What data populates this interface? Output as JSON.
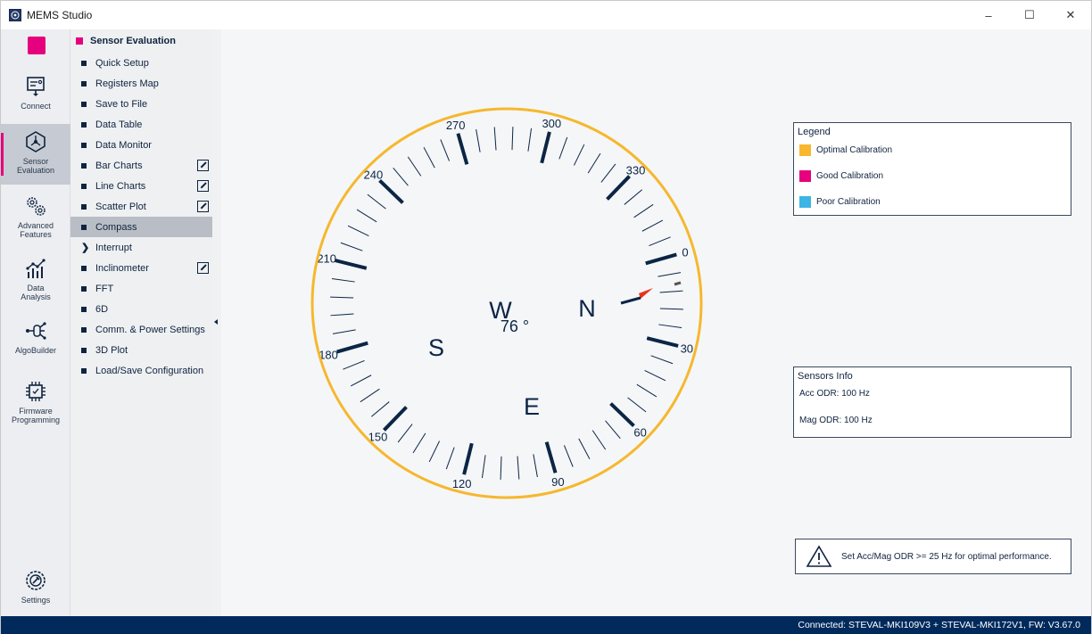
{
  "app": {
    "title": "MEMS Studio"
  },
  "window_controls": {
    "minimize": "–",
    "maximize": "☐",
    "close": "✕"
  },
  "rail": {
    "items": [
      {
        "label": "Connect",
        "icon": "connect-icon",
        "active": false
      },
      {
        "label": "Sensor Evaluation",
        "icon": "sensor-evaluation-icon",
        "active": true
      },
      {
        "label": "Advanced Features",
        "icon": "gears-icon",
        "active": false
      },
      {
        "label": "Data Analysis",
        "icon": "data-analysis-icon",
        "active": false
      },
      {
        "label": "AlgoBuilder",
        "icon": "algobuilder-icon",
        "active": false
      },
      {
        "label": "Firmware Programming",
        "icon": "chip-icon",
        "active": false
      }
    ],
    "settings_label": "Settings"
  },
  "menu": {
    "header": "Sensor Evaluation",
    "items": [
      {
        "label": "Quick Setup",
        "external": false,
        "selected": false
      },
      {
        "label": "Registers Map",
        "external": false,
        "selected": false
      },
      {
        "label": "Save to File",
        "external": false,
        "selected": false
      },
      {
        "label": "Data Table",
        "external": false,
        "selected": false
      },
      {
        "label": "Data Monitor",
        "external": false,
        "selected": false
      },
      {
        "label": "Bar Charts",
        "external": true,
        "selected": false
      },
      {
        "label": "Line Charts",
        "external": true,
        "selected": false
      },
      {
        "label": "Scatter Plot",
        "external": true,
        "selected": false
      },
      {
        "label": "Compass",
        "external": false,
        "selected": true
      },
      {
        "label": "Interrupt",
        "external": false,
        "selected": false,
        "expandable": true
      },
      {
        "label": "Inclinometer",
        "external": true,
        "selected": false
      },
      {
        "label": "FFT",
        "external": false,
        "selected": false
      },
      {
        "label": "6D",
        "external": false,
        "selected": false
      },
      {
        "label": "Comm. & Power Settings",
        "external": false,
        "selected": false
      },
      {
        "label": "3D Plot",
        "external": false,
        "selected": false
      },
      {
        "label": "Load/Save Configuration",
        "external": false,
        "selected": false
      }
    ]
  },
  "compass": {
    "heading_value": "76 °",
    "degree_labels": [
      "0",
      "30",
      "60",
      "90",
      "120",
      "150",
      "180",
      "210",
      "240",
      "270",
      "300",
      "330"
    ],
    "cardinals": {
      "north": "N",
      "east": "E",
      "south": "S",
      "west": "W"
    },
    "ring_color": "#f5b82e",
    "needle_color": "#e8341c",
    "tick_color": "#0b2545"
  },
  "legend": {
    "title": "Legend",
    "items": [
      {
        "label": "Optimal Calibration",
        "color": "#f9b72d"
      },
      {
        "label": "Good Calibration",
        "color": "#e6007e"
      },
      {
        "label": "Poor Calibration",
        "color": "#3cb4e5"
      }
    ]
  },
  "sensors_info": {
    "title": "Sensors Info",
    "acc_odr": "Acc ODR: 100 Hz",
    "mag_odr": "Mag ODR: 100 Hz"
  },
  "warning": {
    "text": "Set Acc/Mag ODR >= 25 Hz for optimal performance.",
    "icon": "warning-icon"
  },
  "status": {
    "text": "Connected:  STEVAL-MKI109V3 + STEVAL-MKI172V1, FW: V3.67.0"
  }
}
